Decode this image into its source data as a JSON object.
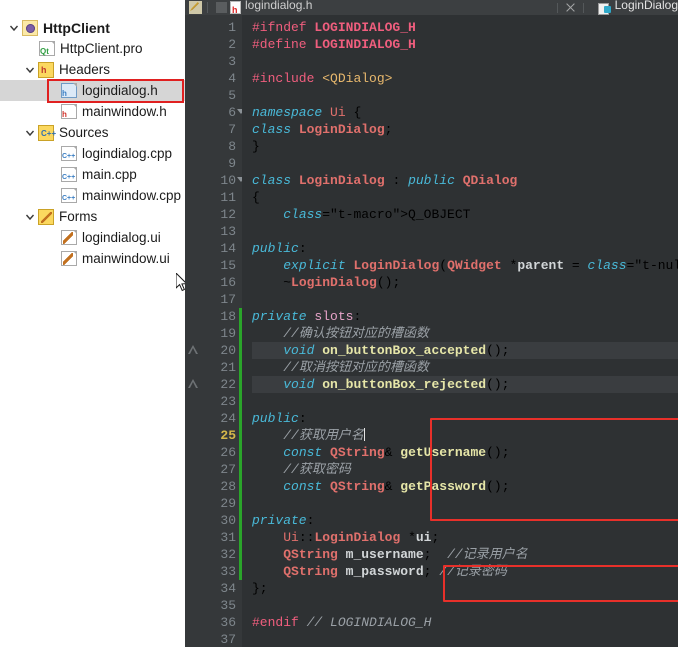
{
  "window": {
    "tab_title": "logindialog.h",
    "right_panel_label": "LoginDialog",
    "tab_icon": "h-header-file-icon",
    "close_label": "×"
  },
  "sidebar": {
    "items": [
      {
        "label": "HttpClient",
        "icon": "project-icon",
        "depth": 0,
        "expanded": true,
        "selected": false
      },
      {
        "label": "HttpClient.pro",
        "icon": "qt-pro-file-icon",
        "depth": 1,
        "expanded": null,
        "selected": false
      },
      {
        "label": "Headers",
        "icon": "headers-folder-icon",
        "depth": 1,
        "expanded": true,
        "selected": false
      },
      {
        "label": "logindialog.h",
        "icon": "h-file-icon",
        "depth": 2,
        "expanded": null,
        "selected": true
      },
      {
        "label": "mainwindow.h",
        "icon": "h-file-icon",
        "depth": 2,
        "expanded": null,
        "selected": false
      },
      {
        "label": "Sources",
        "icon": "sources-folder-icon",
        "depth": 1,
        "expanded": true,
        "selected": false
      },
      {
        "label": "logindialog.cpp",
        "icon": "cpp-file-icon",
        "depth": 2,
        "expanded": null,
        "selected": false
      },
      {
        "label": "main.cpp",
        "icon": "cpp-file-icon",
        "depth": 2,
        "expanded": null,
        "selected": false
      },
      {
        "label": "mainwindow.cpp",
        "icon": "cpp-file-icon",
        "depth": 2,
        "expanded": null,
        "selected": false
      },
      {
        "label": "Forms",
        "icon": "forms-folder-icon",
        "depth": 1,
        "expanded": true,
        "selected": false
      },
      {
        "label": "logindialog.ui",
        "icon": "ui-file-icon",
        "depth": 2,
        "expanded": null,
        "selected": false
      },
      {
        "label": "mainwindow.ui",
        "icon": "ui-file-icon",
        "depth": 2,
        "expanded": null,
        "selected": false
      }
    ]
  },
  "editor": {
    "file": "logindialog.h",
    "current_line": 25,
    "first_line": 1,
    "last_line": 37,
    "warning_lines": [
      20,
      22
    ],
    "changed_lines_from": 18,
    "changed_lines_to": 33,
    "fold_lines": [
      6,
      10
    ],
    "lines": [
      {
        "n": 1,
        "text": "#ifndef LOGINDIALOG_H"
      },
      {
        "n": 2,
        "text": "#define LOGINDIALOG_H"
      },
      {
        "n": 3,
        "text": ""
      },
      {
        "n": 4,
        "text": "#include <QDialog>"
      },
      {
        "n": 5,
        "text": ""
      },
      {
        "n": 6,
        "text": "namespace Ui {"
      },
      {
        "n": 7,
        "text": "class LoginDialog;"
      },
      {
        "n": 8,
        "text": "}"
      },
      {
        "n": 9,
        "text": ""
      },
      {
        "n": 10,
        "text": "class LoginDialog : public QDialog"
      },
      {
        "n": 11,
        "text": "{"
      },
      {
        "n": 12,
        "text": "    Q_OBJECT"
      },
      {
        "n": 13,
        "text": ""
      },
      {
        "n": 14,
        "text": "public:"
      },
      {
        "n": 15,
        "text": "    explicit LoginDialog(QWidget *parent = nullptr);"
      },
      {
        "n": 16,
        "text": "    ~LoginDialog();"
      },
      {
        "n": 17,
        "text": ""
      },
      {
        "n": 18,
        "text": "private slots:"
      },
      {
        "n": 19,
        "text": "    //确认按钮对应的槽函数"
      },
      {
        "n": 20,
        "text": "    void on_buttonBox_accepted();"
      },
      {
        "n": 21,
        "text": "    //取消按钮对应的槽函数"
      },
      {
        "n": 22,
        "text": "    void on_buttonBox_rejected();"
      },
      {
        "n": 23,
        "text": ""
      },
      {
        "n": 24,
        "text": "public:"
      },
      {
        "n": 25,
        "text": "    //获取用户名"
      },
      {
        "n": 26,
        "text": "    const QString& getUsername();"
      },
      {
        "n": 27,
        "text": "    //获取密码"
      },
      {
        "n": 28,
        "text": "    const QString& getPassword();"
      },
      {
        "n": 29,
        "text": ""
      },
      {
        "n": 30,
        "text": "private:"
      },
      {
        "n": 31,
        "text": "    Ui::LoginDialog *ui;"
      },
      {
        "n": 32,
        "text": "    QString m_username;  //记录用户名"
      },
      {
        "n": 33,
        "text": "    QString m_password; //记录密码"
      },
      {
        "n": 34,
        "text": "};"
      },
      {
        "n": 35,
        "text": ""
      },
      {
        "n": 36,
        "text": "#endif // LOGINDIALOG_H"
      },
      {
        "n": 37,
        "text": ""
      }
    ],
    "annotations": [
      {
        "name": "public-getters-highlight",
        "from_line": 24,
        "to_line": 28
      },
      {
        "name": "member-vars-highlight",
        "from_line": 32,
        "to_line": 33
      }
    ]
  },
  "colors": {
    "editor_background": "#2e3133",
    "gutter_background": "#35383a",
    "sidebar_background": "#ffffff",
    "topbar_background": "#3c3f41",
    "annotation_red": "#e8302a",
    "change_bar_green": "#2aa52a",
    "current_line_number": "#d6b84a",
    "selection_gray": "#d6d6d6"
  }
}
